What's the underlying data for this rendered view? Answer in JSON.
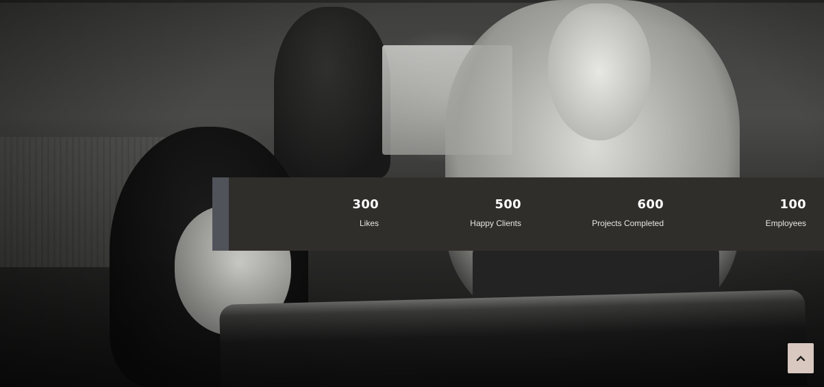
{
  "stats": [
    {
      "value": "300",
      "label": "Likes"
    },
    {
      "value": "500",
      "label": "Happy Clients"
    },
    {
      "value": "600",
      "label": "Projects Completed"
    },
    {
      "value": "100",
      "label": "Employees"
    }
  ],
  "scroll_top": {
    "icon": "chevron-up-icon"
  },
  "colors": {
    "stats_band": "#302e2b",
    "stats_accent": "#50535a",
    "scroll_button": "#d8c8bf"
  }
}
